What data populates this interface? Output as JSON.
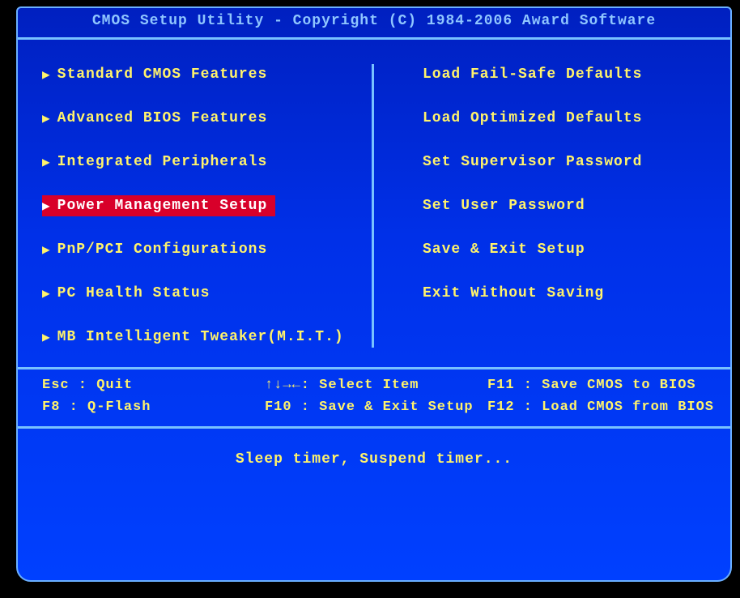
{
  "title": "CMOS Setup Utility - Copyright (C) 1984-2006 Award Software",
  "left_menu": {
    "items": [
      {
        "label": "Standard CMOS Features",
        "selected": false
      },
      {
        "label": "Advanced BIOS Features",
        "selected": false
      },
      {
        "label": "Integrated Peripherals",
        "selected": false
      },
      {
        "label": "Power Management Setup",
        "selected": true
      },
      {
        "label": "PnP/PCI Configurations",
        "selected": false
      },
      {
        "label": "PC Health Status",
        "selected": false
      },
      {
        "label": "MB Intelligent Tweaker(M.I.T.)",
        "selected": false
      }
    ]
  },
  "right_menu": {
    "items": [
      {
        "label": "Load Fail-Safe Defaults"
      },
      {
        "label": "Load Optimized Defaults"
      },
      {
        "label": "Set Supervisor Password"
      },
      {
        "label": "Set User Password"
      },
      {
        "label": "Save & Exit Setup"
      },
      {
        "label": "Exit Without Saving"
      }
    ]
  },
  "help": {
    "r0c0": "Esc : Quit",
    "r0c1": "↑↓→←: Select Item",
    "r0c2": "F11 : Save CMOS to BIOS",
    "r1c0": "F8  : Q-Flash",
    "r1c1": "F10 : Save & Exit Setup",
    "r1c2": "F12 : Load CMOS from BIOS"
  },
  "hint": "Sleep timer, Suspend timer..."
}
